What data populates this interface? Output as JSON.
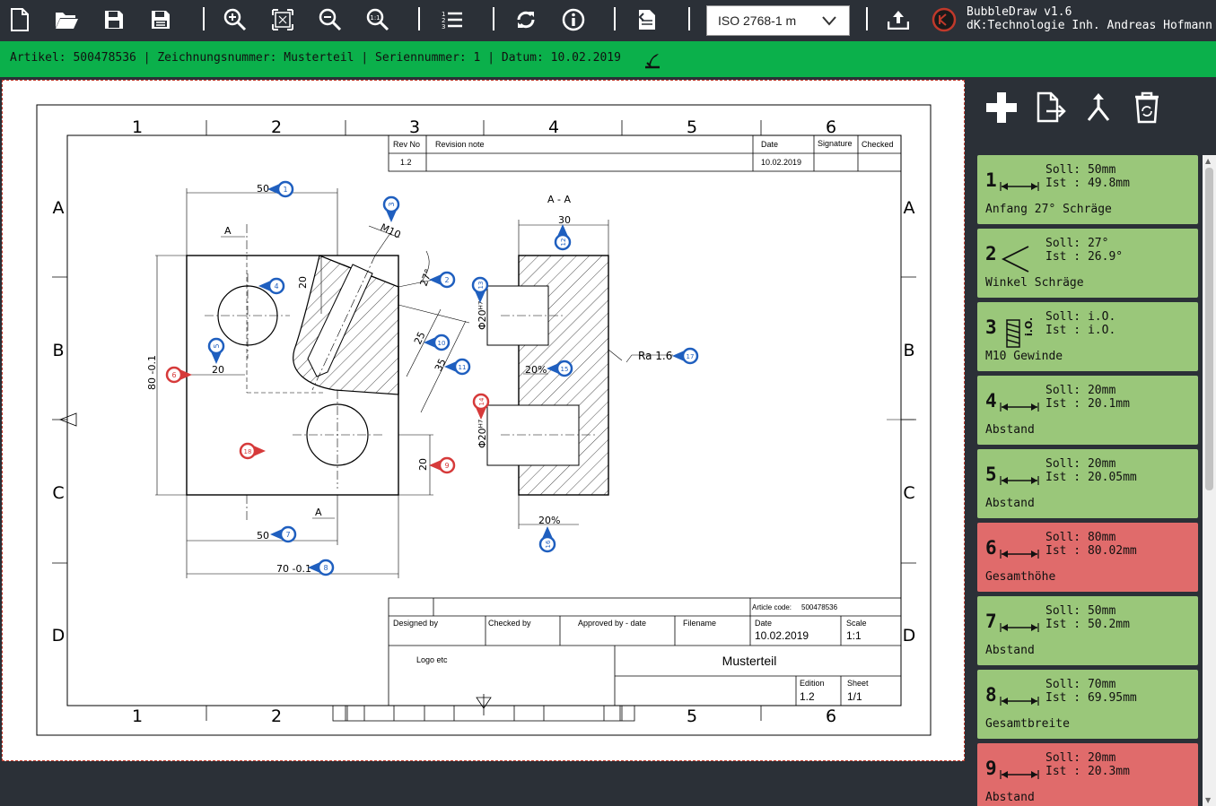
{
  "app": {
    "name": "BubbleDraw v1.6",
    "company": "dK:Technologie Inh. Andreas Hofmann",
    "logo_colors": {
      "red": "#c0392b",
      "dark": "#1a1a1a"
    }
  },
  "toolbar": {
    "icons": [
      "new-file-icon",
      "open-folder-icon",
      "save-icon",
      "save-as-icon",
      "zoom-in-icon",
      "zoom-fit-icon",
      "zoom-out-icon",
      "zoom-reset-icon",
      "numbered-list-icon",
      "refresh-icon",
      "info-icon",
      "pdf-export-icon",
      "upload-icon"
    ],
    "norm_select": "ISO 2768-1 m"
  },
  "infobar": {
    "text": "Artikel: 500478536 | Zeichnungsnummer: Musterteil | Seriennummer: 1 | Datum: 10.02.2019",
    "color": "#0bb04b"
  },
  "drawing": {
    "col_labels": [
      "1",
      "2",
      "3",
      "4",
      "5",
      "6"
    ],
    "row_labels": [
      "A",
      "B",
      "C",
      "D"
    ],
    "revision": {
      "headers": [
        "Rev No",
        "Revision note",
        "Date",
        "Signature",
        "Checked"
      ],
      "row": [
        "1.2",
        "",
        "10.02.2019",
        "",
        ""
      ]
    },
    "section_label": "A - A",
    "cut_label": "A",
    "dims": {
      "d50_top": "50",
      "d20_hole": "20",
      "d20_small": "20",
      "d80": "80 -0.1",
      "d50_bottom": "50",
      "d70": "70 -0.1",
      "d20_right": "20",
      "d27": "27°",
      "dm10": "M10",
      "d25": "25",
      "d35": "35",
      "d30": "30",
      "dphi20a": "Φ20ᴴ⁷",
      "dphi20b": "Φ20ᴴ⁷",
      "d20pct": "20%",
      "d20pct2": "20%",
      "ra": "Ra 1.6"
    },
    "title_block": {
      "article_label": "Article code:",
      "article_value": "500478536",
      "designed_by": "Designed by",
      "checked_by": "Checked by",
      "approved_by": "Approved by - date",
      "filename": "Filename",
      "date_label": "Date",
      "date_value": "10.02.2019",
      "scale_label": "Scale",
      "scale_value": "1:1",
      "logo_text": "Logo etc",
      "title": "Musterteil",
      "edition_label": "Edition",
      "edition_value": "1.2",
      "sheet_label": "Sheet",
      "sheet_value": "1/1"
    },
    "bubbles": [
      {
        "n": "1",
        "status": "ok"
      },
      {
        "n": "2",
        "status": "ok"
      },
      {
        "n": "3",
        "status": "ok"
      },
      {
        "n": "4",
        "status": "ok"
      },
      {
        "n": "5",
        "status": "ok"
      },
      {
        "n": "6",
        "status": "bad"
      },
      {
        "n": "7",
        "status": "ok"
      },
      {
        "n": "8",
        "status": "ok"
      },
      {
        "n": "9",
        "status": "bad"
      },
      {
        "n": "10",
        "status": "ok"
      },
      {
        "n": "11",
        "status": "ok"
      },
      {
        "n": "12",
        "status": "ok"
      },
      {
        "n": "13",
        "status": "ok"
      },
      {
        "n": "14",
        "status": "bad"
      },
      {
        "n": "15",
        "status": "ok"
      },
      {
        "n": "16",
        "status": "ok"
      },
      {
        "n": "17",
        "status": "ok"
      },
      {
        "n": "18",
        "status": "bad"
      }
    ],
    "colors": {
      "ok_bubble": "#1f5fbf",
      "bad_bubble": "#d63a3a"
    }
  },
  "side_tools": [
    "add-icon",
    "import-icon",
    "merge-icon",
    "delete-icon"
  ],
  "measurements": [
    {
      "n": "1",
      "sym": "length",
      "soll": "Soll: 50mm",
      "ist": "Ist : 49.8mm",
      "desc": "Anfang 27° Schräge",
      "status": "ok"
    },
    {
      "n": "2",
      "sym": "angle",
      "soll": "Soll: 27°",
      "ist": "Ist : 26.9°",
      "desc": "Winkel Schräge",
      "status": "ok"
    },
    {
      "n": "3",
      "sym": "thread",
      "soll": "Soll: i.O.",
      "ist": "Ist : i.O.",
      "desc": "M10 Gewinde",
      "status": "ok"
    },
    {
      "n": "4",
      "sym": "length",
      "soll": "Soll: 20mm",
      "ist": "Ist : 20.1mm",
      "desc": "Abstand",
      "status": "ok"
    },
    {
      "n": "5",
      "sym": "length",
      "soll": "Soll: 20mm",
      "ist": "Ist : 20.05mm",
      "desc": "Abstand",
      "status": "ok"
    },
    {
      "n": "6",
      "sym": "length",
      "soll": "Soll: 80mm",
      "ist": "Ist : 80.02mm",
      "desc": "Gesamthöhe",
      "status": "bad"
    },
    {
      "n": "7",
      "sym": "length",
      "soll": "Soll: 50mm",
      "ist": "Ist : 50.2mm",
      "desc": "Abstand",
      "status": "ok"
    },
    {
      "n": "8",
      "sym": "length",
      "soll": "Soll: 70mm",
      "ist": "Ist : 69.95mm",
      "desc": "Gesamtbreite",
      "status": "ok"
    },
    {
      "n": "9",
      "sym": "length",
      "soll": "Soll: 20mm",
      "ist": "Ist : 20.3mm",
      "desc": "Abstand",
      "status": "bad"
    }
  ],
  "colors": {
    "ok_card": "#9ac77a",
    "bad_card": "#e06b6b",
    "background": "#2b3037"
  }
}
